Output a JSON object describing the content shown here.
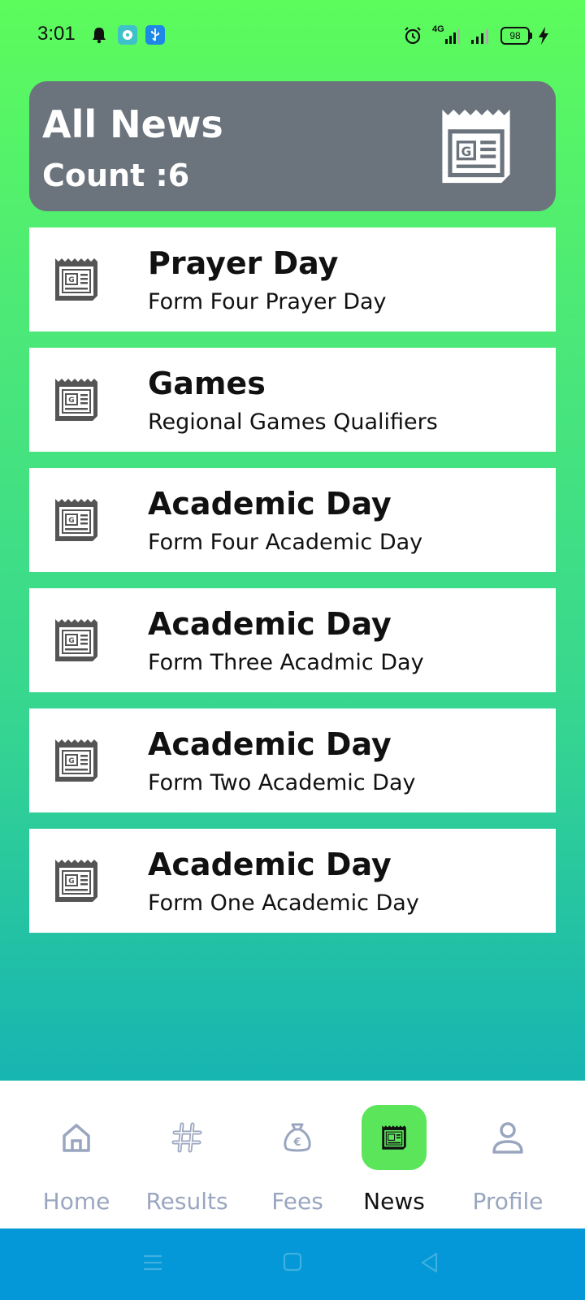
{
  "status_bar": {
    "time": "3:01",
    "battery": "98",
    "network": "4G"
  },
  "header": {
    "title": "All News",
    "count_label": "Count :",
    "count_value": "6",
    "icon": "newspaper-icon"
  },
  "news": [
    {
      "title": "Prayer Day",
      "subtitle": "Form Four Prayer Day",
      "icon": "newspaper-icon"
    },
    {
      "title": "Games",
      "subtitle": "Regional Games Qualifiers",
      "icon": "newspaper-icon"
    },
    {
      "title": "Academic Day",
      "subtitle": "Form Four Academic Day",
      "icon": "newspaper-icon"
    },
    {
      "title": "Academic Day",
      "subtitle": "Form Three Acadmic Day",
      "icon": "newspaper-icon"
    },
    {
      "title": "Academic Day",
      "subtitle": "Form Two Academic Day",
      "icon": "newspaper-icon"
    },
    {
      "title": "Academic Day",
      "subtitle": "Form One Academic Day",
      "icon": "newspaper-icon"
    }
  ],
  "bottom_nav": [
    {
      "label": "Home",
      "icon": "home-icon",
      "active": false
    },
    {
      "label": "Results",
      "icon": "hashtag-icon",
      "active": false
    },
    {
      "label": "Fees",
      "icon": "money-bag-icon",
      "active": false
    },
    {
      "label": "News",
      "icon": "newspaper-icon",
      "active": true
    },
    {
      "label": "Profile",
      "icon": "person-icon",
      "active": false
    }
  ],
  "colors": {
    "header_bg": "#6b737c",
    "nav_active_bg": "#5be55b",
    "nav_inactive_text": "#9aa6bf",
    "system_nav_bg": "#0498d8"
  }
}
